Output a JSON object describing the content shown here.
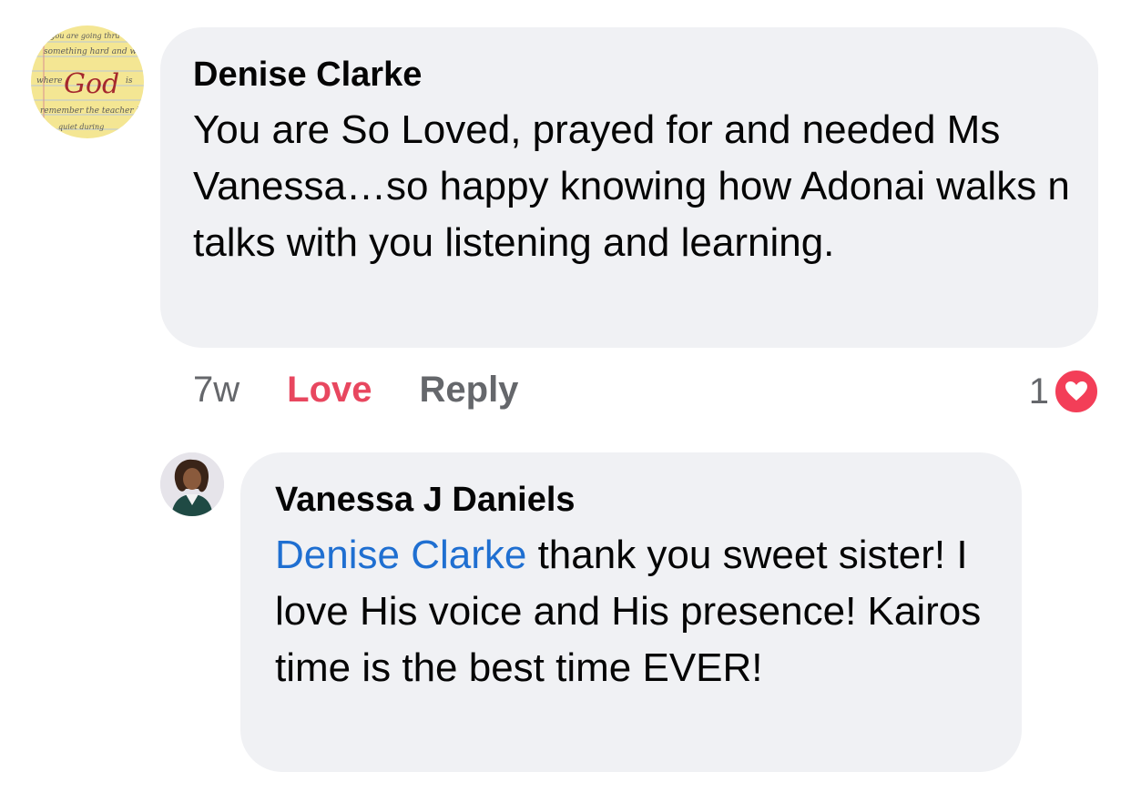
{
  "comment": {
    "author": "Denise Clarke",
    "text": "You are So Loved, prayed for and needed Ms Vanessa…so happy knowing how Adonai walks n talks with you listening and  learning.",
    "avatar_words": [
      "you are going thru",
      "something hard and wonder",
      "where",
      "God",
      "is",
      "remember the teacher is",
      "quiet during"
    ],
    "time": "7w",
    "love_label": "Love",
    "reply_label": "Reply",
    "reaction_count": "1",
    "reaction_icon": "heart-icon"
  },
  "reply": {
    "author": "Vanessa J Daniels",
    "mention": "Denise Clarke",
    "text": " thank you sweet sister! I love His voice and His presence! Kairos time is the best time EVER!"
  },
  "colors": {
    "bubble": "#f0f1f4",
    "love": "#e8475f",
    "mention": "#1f6fd1",
    "muted": "#65676b",
    "heart": "#f33e58"
  }
}
